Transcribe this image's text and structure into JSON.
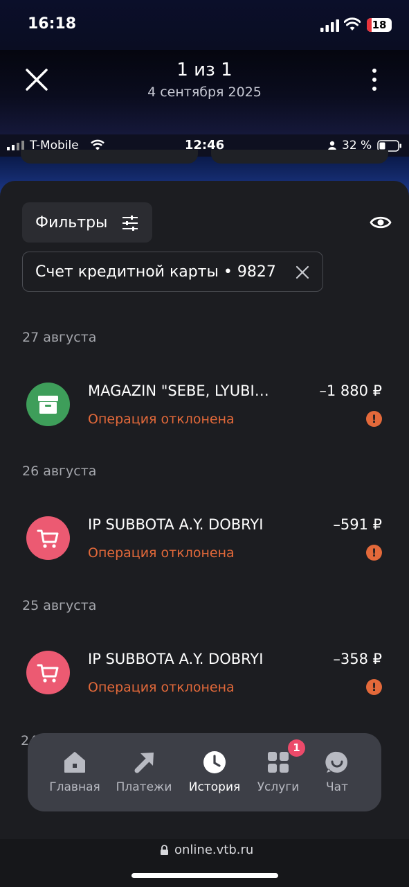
{
  "outer_status": {
    "time": "16:18",
    "battery": "18"
  },
  "viewer": {
    "title": "1 из 1",
    "subtitle": "4 сентября 2025"
  },
  "inner_status": {
    "carrier": "T-Mobile",
    "time": "12:46",
    "battery_pct": "32 %"
  },
  "filters": {
    "label": "Фильтры",
    "active_chip": "Счет кредитной карты • 9827"
  },
  "groups": [
    {
      "date": "27 августа",
      "tx": {
        "merchant": "MAGAZIN \"SEBE, LYUBI…",
        "amount": "–1 880 ₽",
        "status": "Операция отклонена",
        "icon": "archive-box-icon",
        "icon_color": "#3e9e5a"
      }
    },
    {
      "date": "26 августа",
      "tx": {
        "merchant": "IP SUBBOTA A.Y. DOBRYI",
        "amount": "–591 ₽",
        "status": "Операция отклонена",
        "icon": "shopping-cart-icon",
        "icon_color": "#ec5a72"
      }
    },
    {
      "date": "25 августа",
      "tx": {
        "merchant": "IP SUBBOTA A.Y. DOBRYI",
        "amount": "–358 ₽",
        "status": "Операция отклонена",
        "icon": "shopping-cart-icon",
        "icon_color": "#ec5a72"
      }
    }
  ],
  "partial_next_date": "24",
  "tabbar": {
    "items": [
      {
        "label": "Главная",
        "icon": "home-icon"
      },
      {
        "label": "Платежи",
        "icon": "arrow-icon"
      },
      {
        "label": "История",
        "icon": "clock-icon",
        "active": true
      },
      {
        "label": "Услуги",
        "icon": "grid-icon",
        "badge": "1"
      },
      {
        "label": "Чат",
        "icon": "chat-smile-icon"
      }
    ]
  },
  "url": "online.vtb.ru",
  "colors": {
    "accent_orange": "#e3693a",
    "sheet_bg": "#1c1d21",
    "tabbar_bg": "#3d3f47",
    "badge": "#ec4a6a"
  }
}
